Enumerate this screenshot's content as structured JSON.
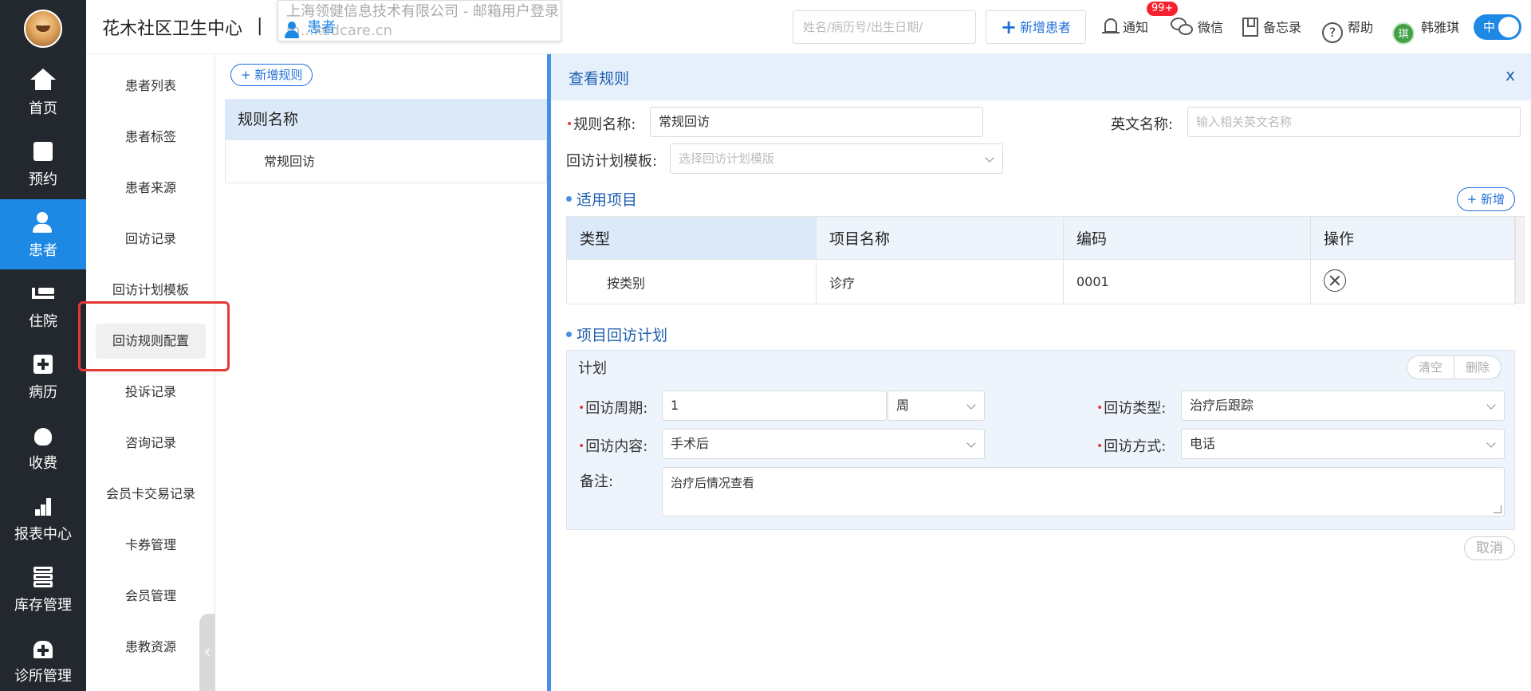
{
  "header": {
    "clinic_name": "花木社区卫生中心",
    "separator": "|",
    "watermark_line1": "上海领健信息技术有限公司 - 邮箱用户登录",
    "watermark_line2": "m...kedcare.cn",
    "watermark_tab": "患者",
    "search_placeholder": "姓名/病历号/出生日期/",
    "new_patient_label": "新增患者",
    "notify_label": "通知",
    "notify_badge": "99+",
    "wechat_label": "微信",
    "memo_label": "备忘录",
    "help_label": "帮助",
    "user_initial": "琪",
    "user_name": "韩雅琪",
    "lang_label": "中",
    "colors": {
      "accent": "#1e88e5",
      "nav_bg": "#23272e",
      "badge": "#f5222d"
    }
  },
  "leftnav": {
    "items": [
      {
        "label": "首页",
        "icon": "home-icon"
      },
      {
        "label": "预约",
        "icon": "calendar-icon"
      },
      {
        "label": "患者",
        "icon": "patient-icon",
        "active": true
      },
      {
        "label": "住院",
        "icon": "bed-icon"
      },
      {
        "label": "病历",
        "icon": "medical-record-icon"
      },
      {
        "label": "收费",
        "icon": "money-bag-icon"
      },
      {
        "label": "报表中心",
        "icon": "bar-chart-icon"
      },
      {
        "label": "库存管理",
        "icon": "layers-icon"
      },
      {
        "label": "诊所管理",
        "icon": "clinic-icon"
      }
    ]
  },
  "subnav": {
    "items": [
      {
        "label": "患者列表"
      },
      {
        "label": "患者标签"
      },
      {
        "label": "患者来源"
      },
      {
        "label": "回访记录"
      },
      {
        "label": "回访计划模板"
      },
      {
        "label": "回访规则配置",
        "selected": true
      },
      {
        "label": "投诉记录"
      },
      {
        "label": "咨询记录"
      },
      {
        "label": "会员卡交易记录"
      },
      {
        "label": "卡券管理"
      },
      {
        "label": "会员管理"
      },
      {
        "label": "患教资源"
      }
    ],
    "collapse_glyph": "‹"
  },
  "rules": {
    "add_label": "+ 新增规则",
    "column_header": "规则名称",
    "rows": [
      "常规回访"
    ]
  },
  "detail": {
    "title": "查看规则",
    "close_label": "x",
    "rule_name_label": "规则名称:",
    "rule_name_value": "常规回访",
    "english_name_label": "英文名称:",
    "english_name_placeholder": "输入相关英文名称",
    "template_label": "回访计划模板:",
    "template_placeholder": "选择回访计划模版",
    "items_section": "适用项目",
    "add_item_label": "+ 新增",
    "items_columns": [
      "类型",
      "项目名称",
      "编码",
      "操作"
    ],
    "items_rows": [
      {
        "type": "按类别",
        "name": "诊疗",
        "code": "0001"
      }
    ],
    "plan_section": "项目回访计划",
    "plan_title": "计划",
    "clear_label": "清空",
    "delete_label": "删除",
    "cycle_label": "回访周期:",
    "cycle_value": "1",
    "cycle_unit": "周",
    "type_label": "回访类型:",
    "type_value": "治疗后跟踪",
    "content_label": "回访内容:",
    "content_value": "手术后",
    "method_label": "回访方式:",
    "method_value": "电话",
    "note_label": "备注:",
    "note_value": "治疗后情况查看",
    "cancel_label": "取消"
  }
}
